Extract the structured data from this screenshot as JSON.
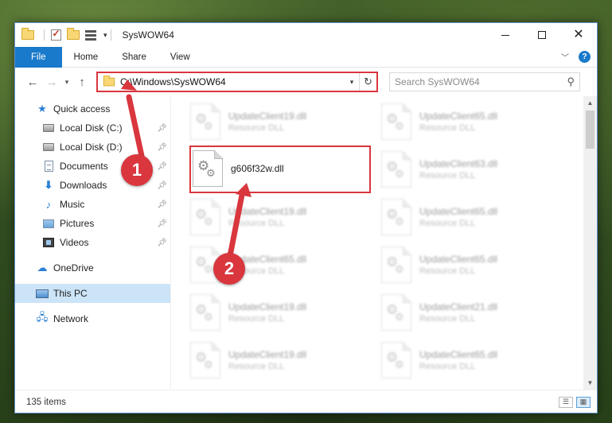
{
  "window": {
    "title": "SysWOW64"
  },
  "ribbon": {
    "tabs": [
      "File",
      "Home",
      "Share",
      "View"
    ]
  },
  "address": {
    "path": "C:\\Windows\\SysWOW64"
  },
  "search": {
    "placeholder": "Search SysWOW64"
  },
  "sidebar": {
    "quick_access": "Quick access",
    "pinned": [
      {
        "label": "Local Disk (C:)",
        "icon": "disk-icon"
      },
      {
        "label": "Local Disk (D:)",
        "icon": "disk-icon"
      },
      {
        "label": "Documents",
        "icon": "documents-icon"
      },
      {
        "label": "Downloads",
        "icon": "downloads-icon"
      },
      {
        "label": "Music",
        "icon": "music-icon"
      },
      {
        "label": "Pictures",
        "icon": "pictures-icon"
      },
      {
        "label": "Videos",
        "icon": "videos-icon"
      }
    ],
    "onedrive": "OneDrive",
    "this_pc": "This PC",
    "network": "Network"
  },
  "files": {
    "highlighted": {
      "name": "g606f32w.dll"
    },
    "faded": [
      {
        "name": "UpdateClient19.dll",
        "type": "Resource DLL"
      },
      {
        "name": "UpdateClient65.dll",
        "type": "Resource DLL"
      },
      {
        "name": "UpdateClient63.dll",
        "type": "Resource DLL"
      },
      {
        "name": "UpdateClient19.dll",
        "type": "Resource DLL"
      },
      {
        "name": "UpdateClient65.dll",
        "type": "Resource DLL"
      },
      {
        "name": "UpdateClient65.dll",
        "type": "Resource DLL"
      },
      {
        "name": "UpdateClient65.dll",
        "type": "Resource DLL"
      },
      {
        "name": "UpdateClient19.dll",
        "type": "Resource DLL"
      },
      {
        "name": "UpdateClient21.dll",
        "type": "Resource DLL"
      },
      {
        "name": "UpdateClient19.dll",
        "type": "Resource DLL"
      },
      {
        "name": "UpdateClient65.dll",
        "type": "Resource DLL"
      }
    ]
  },
  "status": {
    "item_count": "135 items"
  },
  "annotations": {
    "step1": "1",
    "step2": "2"
  },
  "colors": {
    "accent": "#1979ca",
    "highlight": "#d9363e",
    "selected": "#cce4f7"
  }
}
